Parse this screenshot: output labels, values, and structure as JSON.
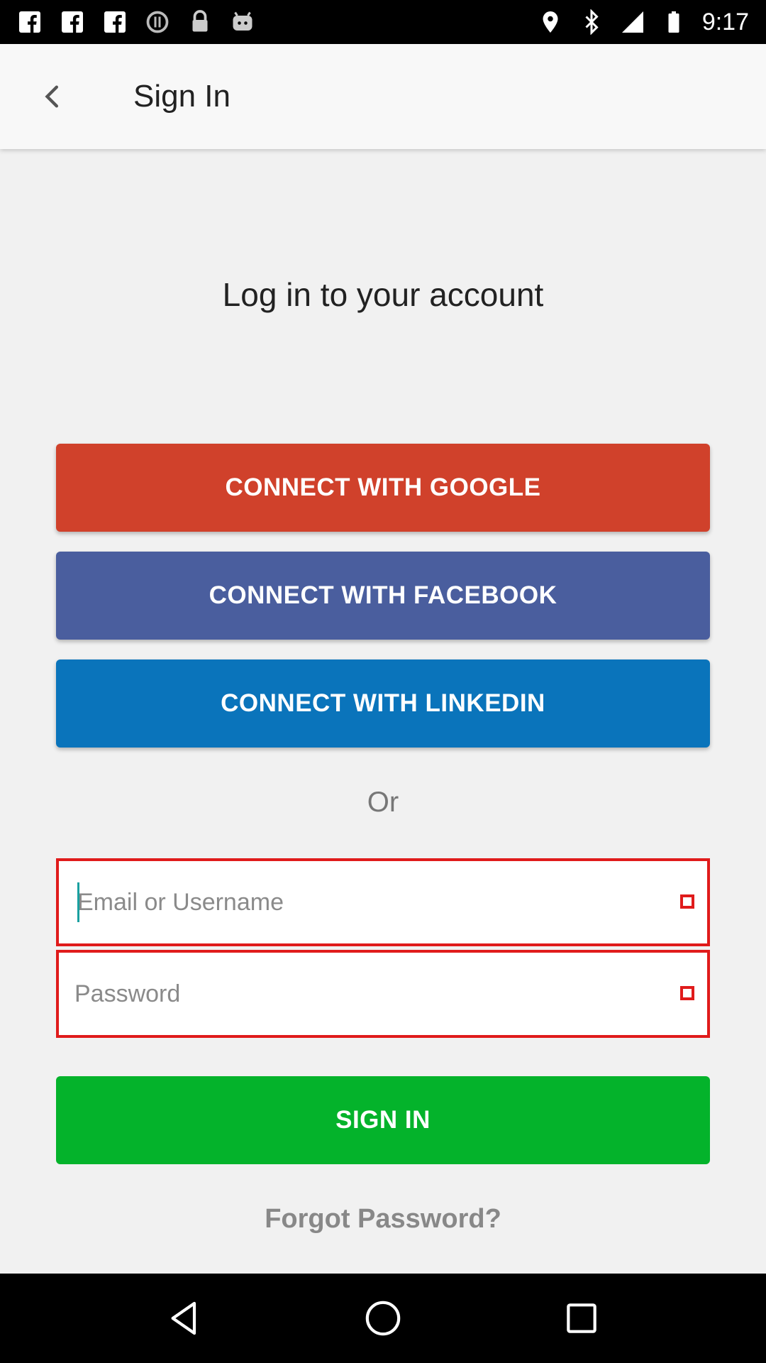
{
  "status_bar": {
    "time": "9:17",
    "left_icons": [
      "facebook-icon",
      "facebook-icon",
      "facebook-icon",
      "circle-off-icon",
      "lock-icon",
      "android-icon"
    ],
    "right_icons": [
      "location-icon",
      "bluetooth-icon",
      "signal-icon",
      "battery-icon"
    ]
  },
  "app_bar": {
    "title": "Sign In",
    "back_icon": "chevron-left-icon"
  },
  "main": {
    "heading": "Log in to your account",
    "google_label": "CONNECT WITH GOOGLE",
    "facebook_label": "CONNECT WITH FACEBOOK",
    "linkedin_label": "CONNECT WITH LINKEDIN",
    "or_label": "Or",
    "email_placeholder": "Email or Username",
    "password_placeholder": "Password",
    "signin_label": "SIGN IN",
    "forgot_label": "Forgot Password?"
  },
  "colors": {
    "google": "#d0412b",
    "facebook": "#4a5e9e",
    "linkedin": "#0a74bb",
    "signin": "#04b32b",
    "error": "#e01b1b"
  },
  "nav_bar": {
    "icons": [
      "back-triangle-icon",
      "home-circle-icon",
      "recents-square-icon"
    ]
  }
}
